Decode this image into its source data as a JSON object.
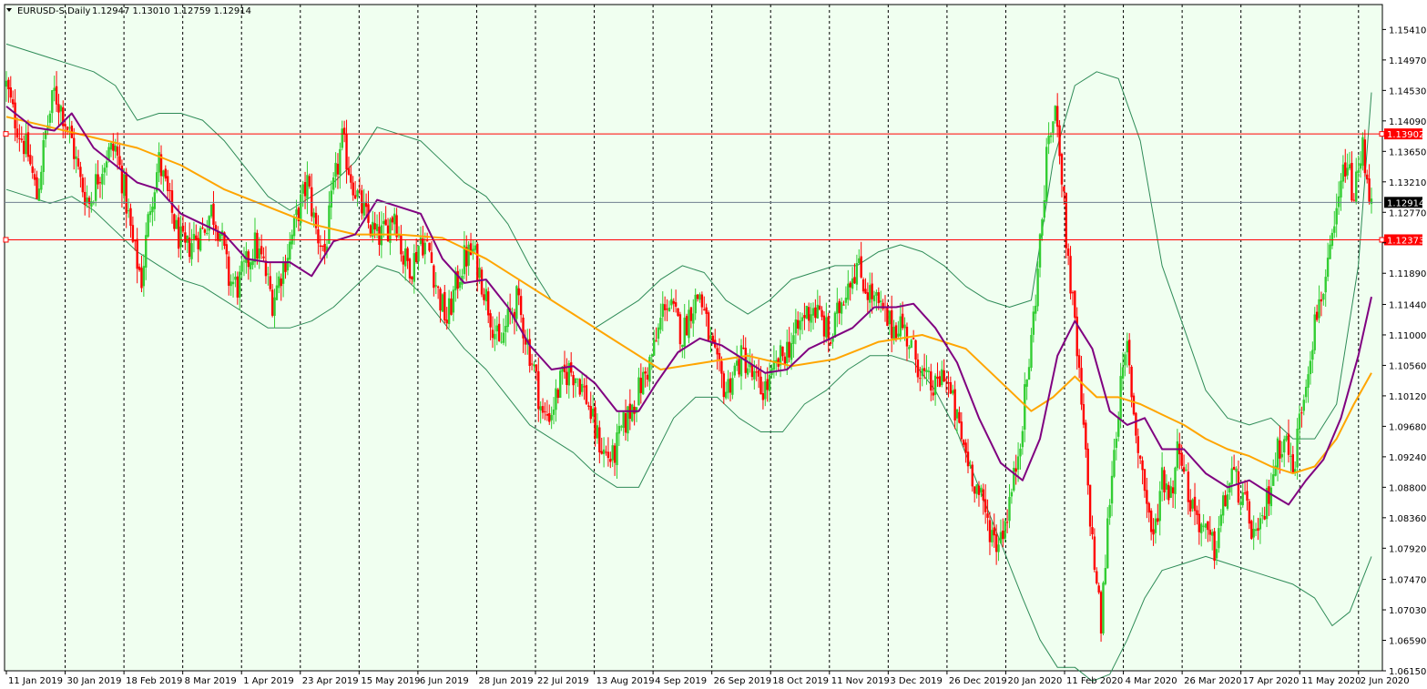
{
  "window": {
    "symbol_label": "EURUSD-S,Daily",
    "ohlc_label": "1.12947 1.13010 1.12759 1.12914"
  },
  "colors": {
    "background": "#f0fff0",
    "bull": "#32cd32",
    "bear": "#ff0000",
    "ma_fast": "#800080",
    "ma_slow": "#ffa500",
    "bands": "#2e8b57",
    "hline": "#ff0000",
    "bid_line": "#708090",
    "grid_vertical": "#000000"
  },
  "chart_data": {
    "type": "candlestick",
    "symbol": "EURUSD-S",
    "timeframe": "Daily",
    "last_ohlc": {
      "open": 1.12947,
      "high": 1.1301,
      "low": 1.12759,
      "close": 1.12914
    },
    "ylim": [
      1.0615,
      1.1577
    ],
    "y_ticks": [
      "1.15410",
      "1.14970",
      "1.14530",
      "1.14090",
      "1.13650",
      "1.13210",
      "1.12770",
      "1.12330",
      "1.11890",
      "1.11440",
      "1.11000",
      "1.10560",
      "1.10120",
      "1.09680",
      "1.09240",
      "1.08800",
      "1.08360",
      "1.07920",
      "1.07470",
      "1.07030",
      "1.06590",
      "1.06150"
    ],
    "x_ticks": [
      "11 Jan 2019",
      "30 Jan 2019",
      "18 Feb 2019",
      "8 Mar 2019",
      "1 Apr 2019",
      "23 Apr 2019",
      "15 May 2019",
      "6 Jun 2019",
      "28 Jun 2019",
      "22 Jul 2019",
      "13 Aug 2019",
      "4 Sep 2019",
      "26 Sep 2019",
      "18 Oct 2019",
      "11 Nov 2019",
      "3 Dec 2019",
      "26 Dec 2019",
      "20 Jan 2020",
      "11 Feb 2020",
      "4 Mar 2020",
      "26 Mar 2020",
      "17 Apr 2020",
      "11 May 2020",
      "2 Jun 2020"
    ],
    "horizontal_lines": [
      {
        "price": 1.13902,
        "label": "1.13902"
      },
      {
        "price": 1.12373,
        "label": "1.12373"
      }
    ],
    "bid_price": {
      "price": 1.12914,
      "label": "1.12914"
    },
    "close_path": [
      [
        0,
        1.146
      ],
      [
        3,
        1.142
      ],
      [
        7,
        1.1385
      ],
      [
        10,
        1.136
      ],
      [
        14,
        1.13
      ],
      [
        18,
        1.139
      ],
      [
        22,
        1.145
      ],
      [
        26,
        1.142
      ],
      [
        30,
        1.138
      ],
      [
        34,
        1.132
      ],
      [
        38,
        1.129
      ],
      [
        42,
        1.133
      ],
      [
        46,
        1.136
      ],
      [
        50,
        1.137
      ],
      [
        54,
        1.131
      ],
      [
        58,
        1.123
      ],
      [
        62,
        1.118
      ],
      [
        66,
        1.129
      ],
      [
        70,
        1.135
      ],
      [
        74,
        1.13
      ],
      [
        78,
        1.125
      ],
      [
        82,
        1.122
      ],
      [
        86,
        1.124
      ],
      [
        90,
        1.125
      ],
      [
        94,
        1.128
      ],
      [
        98,
        1.125
      ],
      [
        102,
        1.118
      ],
      [
        106,
        1.117
      ],
      [
        110,
        1.12
      ],
      [
        114,
        1.123
      ],
      [
        118,
        1.12
      ],
      [
        122,
        1.115
      ],
      [
        126,
        1.119
      ],
      [
        130,
        1.123
      ],
      [
        134,
        1.128
      ],
      [
        138,
        1.132
      ],
      [
        142,
        1.125
      ],
      [
        146,
        1.122
      ],
      [
        150,
        1.131
      ],
      [
        154,
        1.138
      ],
      [
        158,
        1.133
      ],
      [
        162,
        1.129
      ],
      [
        166,
        1.126
      ],
      [
        170,
        1.124
      ],
      [
        174,
        1.125
      ],
      [
        178,
        1.128
      ],
      [
        182,
        1.121
      ],
      [
        186,
        1.12
      ],
      [
        190,
        1.124
      ],
      [
        194,
        1.122
      ],
      [
        198,
        1.116
      ],
      [
        202,
        1.112
      ],
      [
        206,
        1.117
      ],
      [
        210,
        1.121
      ],
      [
        214,
        1.122
      ],
      [
        218,
        1.118
      ],
      [
        222,
        1.113
      ],
      [
        226,
        1.108
      ],
      [
        230,
        1.112
      ],
      [
        234,
        1.115
      ],
      [
        238,
        1.11
      ],
      [
        242,
        1.105
      ],
      [
        246,
        1.098
      ],
      [
        250,
        1.099
      ],
      [
        254,
        1.103
      ],
      [
        258,
        1.105
      ],
      [
        262,
        1.104
      ],
      [
        266,
        1.101
      ],
      [
        270,
        1.096
      ],
      [
        274,
        1.093
      ],
      [
        278,
        1.092
      ],
      [
        282,
        1.096
      ],
      [
        286,
        1.099
      ],
      [
        290,
        1.102
      ],
      [
        294,
        1.105
      ],
      [
        298,
        1.109
      ],
      [
        302,
        1.115
      ],
      [
        306,
        1.113
      ],
      [
        310,
        1.11
      ],
      [
        314,
        1.114
      ],
      [
        318,
        1.116
      ],
      [
        322,
        1.11
      ],
      [
        326,
        1.105
      ],
      [
        330,
        1.102
      ],
      [
        334,
        1.105
      ],
      [
        338,
        1.107
      ],
      [
        342,
        1.104
      ],
      [
        346,
        1.102
      ],
      [
        350,
        1.103
      ],
      [
        354,
        1.106
      ],
      [
        358,
        1.108
      ],
      [
        362,
        1.11
      ],
      [
        366,
        1.113
      ],
      [
        370,
        1.114
      ],
      [
        374,
        1.112
      ],
      [
        378,
        1.109
      ],
      [
        382,
        1.114
      ],
      [
        386,
        1.118
      ],
      [
        390,
        1.12
      ],
      [
        394,
        1.117
      ],
      [
        398,
        1.115
      ],
      [
        402,
        1.113
      ],
      [
        406,
        1.111
      ],
      [
        410,
        1.112
      ],
      [
        414,
        1.109
      ],
      [
        418,
        1.106
      ],
      [
        422,
        1.103
      ],
      [
        426,
        1.102
      ],
      [
        430,
        1.105
      ],
      [
        434,
        1.1
      ],
      [
        438,
        1.095
      ],
      [
        442,
        1.091
      ],
      [
        446,
        1.087
      ],
      [
        450,
        1.083
      ],
      [
        454,
        1.08
      ],
      [
        458,
        1.083
      ],
      [
        462,
        1.089
      ],
      [
        466,
        1.098
      ],
      [
        470,
        1.109
      ],
      [
        474,
        1.123
      ],
      [
        478,
        1.139
      ],
      [
        482,
        1.142
      ],
      [
        486,
        1.124
      ],
      [
        490,
        1.111
      ],
      [
        494,
        1.096
      ],
      [
        498,
        1.08
      ],
      [
        502,
        1.068
      ],
      [
        506,
        1.087
      ],
      [
        510,
        1.1
      ],
      [
        514,
        1.108
      ],
      [
        518,
        1.096
      ],
      [
        522,
        1.088
      ],
      [
        526,
        1.08
      ],
      [
        530,
        1.09
      ],
      [
        534,
        1.087
      ],
      [
        538,
        1.095
      ],
      [
        542,
        1.087
      ],
      [
        546,
        1.084
      ],
      [
        550,
        1.081
      ],
      [
        554,
        1.079
      ],
      [
        558,
        1.085
      ],
      [
        562,
        1.09
      ],
      [
        566,
        1.087
      ],
      [
        570,
        1.083
      ],
      [
        574,
        1.08
      ],
      [
        578,
        1.086
      ],
      [
        582,
        1.092
      ],
      [
        586,
        1.096
      ],
      [
        590,
        1.09
      ],
      [
        594,
        1.1
      ],
      [
        598,
        1.108
      ],
      [
        602,
        1.115
      ],
      [
        606,
        1.119
      ],
      [
        610,
        1.127
      ],
      [
        614,
        1.135
      ],
      [
        618,
        1.13
      ],
      [
        622,
        1.137
      ],
      [
        626,
        1.1291
      ]
    ],
    "ma_fast_path": [
      [
        0,
        1.143
      ],
      [
        12,
        1.14
      ],
      [
        22,
        1.1395
      ],
      [
        30,
        1.142
      ],
      [
        40,
        1.137
      ],
      [
        50,
        1.1345
      ],
      [
        60,
        1.132
      ],
      [
        70,
        1.131
      ],
      [
        80,
        1.1275
      ],
      [
        90,
        1.126
      ],
      [
        100,
        1.1245
      ],
      [
        110,
        1.121
      ],
      [
        120,
        1.1205
      ],
      [
        130,
        1.1205
      ],
      [
        140,
        1.1185
      ],
      [
        150,
        1.1235
      ],
      [
        160,
        1.1245
      ],
      [
        170,
        1.1295
      ],
      [
        180,
        1.1285
      ],
      [
        190,
        1.1275
      ],
      [
        200,
        1.121
      ],
      [
        210,
        1.1175
      ],
      [
        220,
        1.118
      ],
      [
        230,
        1.114
      ],
      [
        240,
        1.1085
      ],
      [
        250,
        1.105
      ],
      [
        260,
        1.1055
      ],
      [
        270,
        1.103
      ],
      [
        280,
        1.099
      ],
      [
        290,
        1.099
      ],
      [
        298,
        1.103
      ],
      [
        308,
        1.1075
      ],
      [
        318,
        1.1095
      ],
      [
        328,
        1.1085
      ],
      [
        338,
        1.1065
      ],
      [
        348,
        1.1045
      ],
      [
        358,
        1.105
      ],
      [
        368,
        1.108
      ],
      [
        378,
        1.1095
      ],
      [
        388,
        1.111
      ],
      [
        398,
        1.114
      ],
      [
        408,
        1.114
      ],
      [
        416,
        1.1145
      ],
      [
        426,
        1.111
      ],
      [
        436,
        1.106
      ],
      [
        446,
        1.098
      ],
      [
        456,
        1.0915
      ],
      [
        466,
        1.089
      ],
      [
        474,
        1.095
      ],
      [
        482,
        1.107
      ],
      [
        490,
        1.112
      ],
      [
        498,
        1.108
      ],
      [
        506,
        1.099
      ],
      [
        514,
        1.097
      ],
      [
        522,
        1.098
      ],
      [
        530,
        1.0935
      ],
      [
        540,
        1.0935
      ],
      [
        550,
        1.09
      ],
      [
        560,
        1.088
      ],
      [
        570,
        1.089
      ],
      [
        580,
        1.087
      ],
      [
        588,
        1.0855
      ],
      [
        596,
        1.089
      ],
      [
        604,
        1.092
      ],
      [
        612,
        1.098
      ],
      [
        620,
        1.107
      ],
      [
        626,
        1.1155
      ]
    ],
    "ma_slow_path": [
      [
        0,
        1.1415
      ],
      [
        20,
        1.14
      ],
      [
        40,
        1.1385
      ],
      [
        60,
        1.137
      ],
      [
        80,
        1.1345
      ],
      [
        100,
        1.131
      ],
      [
        120,
        1.1285
      ],
      [
        140,
        1.126
      ],
      [
        160,
        1.1245
      ],
      [
        180,
        1.1245
      ],
      [
        200,
        1.124
      ],
      [
        220,
        1.121
      ],
      [
        240,
        1.117
      ],
      [
        260,
        1.113
      ],
      [
        280,
        1.109
      ],
      [
        300,
        1.105
      ],
      [
        320,
        1.106
      ],
      [
        340,
        1.107
      ],
      [
        360,
        1.1055
      ],
      [
        380,
        1.1065
      ],
      [
        400,
        1.109
      ],
      [
        420,
        1.11
      ],
      [
        440,
        1.108
      ],
      [
        460,
        1.102
      ],
      [
        470,
        1.099
      ],
      [
        480,
        1.101
      ],
      [
        490,
        1.104
      ],
      [
        500,
        1.101
      ],
      [
        510,
        1.101
      ],
      [
        520,
        1.1
      ],
      [
        530,
        1.0985
      ],
      [
        540,
        1.097
      ],
      [
        550,
        1.095
      ],
      [
        560,
        1.0935
      ],
      [
        570,
        1.0925
      ],
      [
        580,
        1.091
      ],
      [
        590,
        1.09
      ],
      [
        600,
        1.091
      ],
      [
        610,
        1.095
      ],
      [
        618,
        1.1
      ],
      [
        626,
        1.1045
      ]
    ],
    "band_upper_path": [
      [
        0,
        1.152
      ],
      [
        10,
        1.151
      ],
      [
        20,
        1.15
      ],
      [
        30,
        1.149
      ],
      [
        40,
        1.148
      ],
      [
        50,
        1.146
      ],
      [
        60,
        1.141
      ],
      [
        70,
        1.142
      ],
      [
        80,
        1.142
      ],
      [
        90,
        1.141
      ],
      [
        100,
        1.138
      ],
      [
        110,
        1.134
      ],
      [
        120,
        1.13
      ],
      [
        130,
        1.128
      ],
      [
        140,
        1.13
      ],
      [
        150,
        1.132
      ],
      [
        160,
        1.135
      ],
      [
        170,
        1.14
      ],
      [
        180,
        1.139
      ],
      [
        190,
        1.138
      ],
      [
        200,
        1.135
      ],
      [
        210,
        1.132
      ],
      [
        220,
        1.13
      ],
      [
        230,
        1.126
      ],
      [
        240,
        1.12
      ],
      [
        250,
        1.115
      ],
      [
        260,
        1.113
      ],
      [
        270,
        1.111
      ],
      [
        280,
        1.113
      ],
      [
        290,
        1.115
      ],
      [
        300,
        1.118
      ],
      [
        310,
        1.12
      ],
      [
        320,
        1.119
      ],
      [
        330,
        1.115
      ],
      [
        340,
        1.113
      ],
      [
        350,
        1.115
      ],
      [
        360,
        1.118
      ],
      [
        370,
        1.119
      ],
      [
        380,
        1.12
      ],
      [
        390,
        1.12
      ],
      [
        400,
        1.122
      ],
      [
        410,
        1.123
      ],
      [
        420,
        1.122
      ],
      [
        430,
        1.12
      ],
      [
        440,
        1.117
      ],
      [
        450,
        1.115
      ],
      [
        460,
        1.114
      ],
      [
        470,
        1.115
      ],
      [
        480,
        1.135
      ],
      [
        490,
        1.146
      ],
      [
        500,
        1.148
      ],
      [
        510,
        1.147
      ],
      [
        520,
        1.138
      ],
      [
        530,
        1.12
      ],
      [
        540,
        1.111
      ],
      [
        550,
        1.102
      ],
      [
        560,
        1.098
      ],
      [
        570,
        1.097
      ],
      [
        580,
        1.098
      ],
      [
        590,
        1.095
      ],
      [
        600,
        1.095
      ],
      [
        610,
        1.1
      ],
      [
        620,
        1.12
      ],
      [
        626,
        1.145
      ]
    ],
    "band_lower_path": [
      [
        0,
        1.131
      ],
      [
        10,
        1.13
      ],
      [
        20,
        1.129
      ],
      [
        30,
        1.13
      ],
      [
        40,
        1.128
      ],
      [
        50,
        1.125
      ],
      [
        60,
        1.122
      ],
      [
        70,
        1.12
      ],
      [
        80,
        1.118
      ],
      [
        90,
        1.117
      ],
      [
        100,
        1.115
      ],
      [
        110,
        1.113
      ],
      [
        120,
        1.111
      ],
      [
        130,
        1.111
      ],
      [
        140,
        1.112
      ],
      [
        150,
        1.114
      ],
      [
        160,
        1.117
      ],
      [
        170,
        1.12
      ],
      [
        180,
        1.119
      ],
      [
        190,
        1.116
      ],
      [
        200,
        1.112
      ],
      [
        210,
        1.108
      ],
      [
        220,
        1.105
      ],
      [
        230,
        1.101
      ],
      [
        240,
        1.097
      ],
      [
        250,
        1.095
      ],
      [
        260,
        1.093
      ],
      [
        270,
        1.09
      ],
      [
        280,
        1.088
      ],
      [
        290,
        1.088
      ],
      [
        298,
        1.093
      ],
      [
        306,
        1.098
      ],
      [
        316,
        1.101
      ],
      [
        326,
        1.101
      ],
      [
        336,
        1.098
      ],
      [
        346,
        1.096
      ],
      [
        356,
        1.096
      ],
      [
        366,
        1.1
      ],
      [
        376,
        1.102
      ],
      [
        386,
        1.105
      ],
      [
        396,
        1.107
      ],
      [
        406,
        1.107
      ],
      [
        416,
        1.106
      ],
      [
        426,
        1.102
      ],
      [
        436,
        1.096
      ],
      [
        446,
        1.088
      ],
      [
        456,
        1.08
      ],
      [
        466,
        1.072
      ],
      [
        474,
        1.066
      ],
      [
        482,
        1.062
      ],
      [
        490,
        1.062
      ],
      [
        498,
        1.06
      ],
      [
        506,
        1.061
      ],
      [
        514,
        1.066
      ],
      [
        522,
        1.072
      ],
      [
        530,
        1.076
      ],
      [
        540,
        1.077
      ],
      [
        550,
        1.078
      ],
      [
        560,
        1.077
      ],
      [
        570,
        1.076
      ],
      [
        580,
        1.075
      ],
      [
        590,
        1.074
      ],
      [
        600,
        1.072
      ],
      [
        608,
        1.068
      ],
      [
        616,
        1.07
      ],
      [
        626,
        1.078
      ]
    ]
  }
}
